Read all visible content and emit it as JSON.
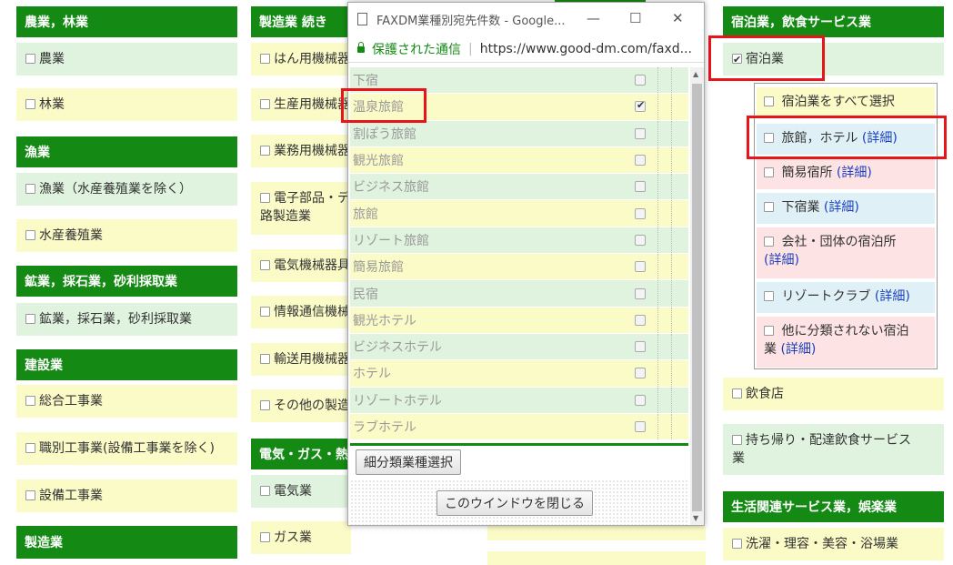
{
  "col1": {
    "h_agri": "農業，林業",
    "agri": "農業",
    "forest": "林業",
    "h_fish": "漁業",
    "fish": "漁業（水産養殖業を除く）",
    "aqua": "水産養殖業",
    "h_mining": "鉱業，採石業，砂利採取業",
    "mining": "鉱業，採石業，砂利採取業",
    "h_const": "建設業",
    "general": "総合工事業",
    "job": "職別工事業(設備工事業を除く)",
    "equip": "設備工事業",
    "h_mfg": "製造業"
  },
  "col2": {
    "h_mfg2": "製造業 続き",
    "i1": "はん用機械器",
    "i2": "生産用機械器",
    "i3": "業務用機械器",
    "i4a": "電子部品・デ",
    "i4b": "路製造業",
    "i5": "電気機械器具",
    "i6": "情報通信機械",
    "i7": "輸送用機械器",
    "i8": "その他の製造",
    "h_elec": "電気・ガス・熱",
    "e1": "電気業",
    "e2": "ガス業"
  },
  "col4": {
    "h_lodging": "宿泊業，飲食サービス業",
    "lodging": "宿泊業",
    "sub_all": "宿泊業をすべて選択",
    "sub_ryokan": "旅館，ホテル",
    "sub_simple": "簡易宿所",
    "sub_boarding": "下宿業",
    "sub_company_a": "会社・団体の宿泊所",
    "sub_resort": "リゾートクラブ",
    "sub_other_a": "他に分類されない宿泊",
    "sub_other_b": "業",
    "detail": "(詳細)",
    "food": "飲食店",
    "takeout_a": "持ち帰り・配達飲食サービス",
    "takeout_b": "業",
    "h_life": "生活関連サービス業，娯楽業",
    "laundry": "洗濯・理容・美容・浴場業"
  },
  "window": {
    "title": "FAXDM業種別宛先件数 - Google...",
    "secure": "保護された通信",
    "url": "https://www.good-dm.com/faxd...",
    "items": [
      {
        "label": "下宿",
        "checked": false
      },
      {
        "label": "温泉旅館",
        "checked": true
      },
      {
        "label": "割ぽう旅館",
        "checked": false
      },
      {
        "label": "観光旅館",
        "checked": false
      },
      {
        "label": "ビジネス旅館",
        "checked": false
      },
      {
        "label": "旅館",
        "checked": false
      },
      {
        "label": "リゾート旅館",
        "checked": false
      },
      {
        "label": "簡易旅館",
        "checked": false
      },
      {
        "label": "民宿",
        "checked": false
      },
      {
        "label": "観光ホテル",
        "checked": false
      },
      {
        "label": "ビジネスホテル",
        "checked": false
      },
      {
        "label": "ホテル",
        "checked": false
      },
      {
        "label": "リゾートホテル",
        "checked": false
      },
      {
        "label": "ラブホテル",
        "checked": false
      }
    ],
    "select_btn": "細分類業種選択",
    "close_btn": "このウインドウを閉じる"
  },
  "colors": {
    "header_green": "#148a14",
    "row_green": "#dff3df",
    "row_yellow": "#fbfbc8",
    "highlight_red": "#e8141a",
    "link_blue": "#1a3fbf"
  }
}
